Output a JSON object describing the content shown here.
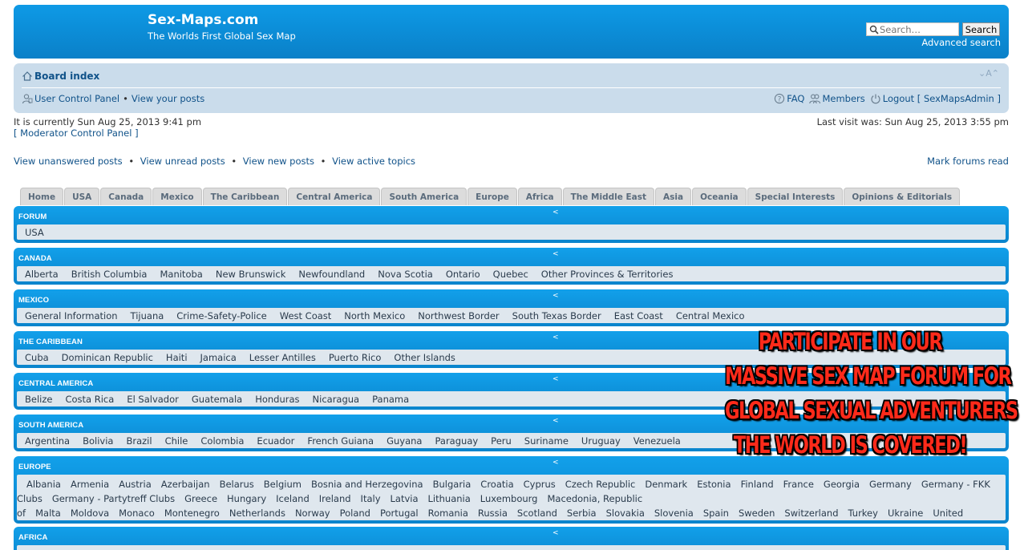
{
  "header": {
    "title": "Sex-Maps.com",
    "description": "The Worlds First Global Sex Map",
    "search_placeholder": "Search…",
    "search_button": "Search",
    "advanced_search": "Advanced search",
    "bg_color": "#0e8fd8"
  },
  "navbar": {
    "board_index": "Board index",
    "font_size_control": "⌄A⌃",
    "ucp": "User Control Panel",
    "view_posts": "View your posts",
    "faq": "FAQ",
    "members": "Members",
    "logout": "Logout [ SexMapsAdmin ]"
  },
  "status": {
    "current_time": "It is currently Sun Aug 25, 2013 9:41 pm",
    "mcp": "[ Moderator Control Panel ]",
    "last_visit": "Last visit was: Sun Aug 25, 2013 3:55 pm"
  },
  "actions": {
    "unanswered": "View unanswered posts",
    "unread": "View unread posts",
    "new": "View new posts",
    "active": "View active topics",
    "mark_read": "Mark forums read"
  },
  "tabs": [
    "Home",
    "USA",
    "Canada",
    "Mexico",
    "The Caribbean",
    "Central America",
    "South America",
    "Europe",
    "Africa",
    "The Middle East",
    "Asia",
    "Oceania",
    "Special Interests",
    "Opinions & Editorials"
  ],
  "caret": "<",
  "blocks": [
    {
      "heading": "Forum",
      "items": [
        "USA"
      ]
    },
    {
      "heading": "Canada",
      "items": [
        "Alberta",
        "British Columbia",
        "Manitoba",
        "New Brunswick",
        "Newfoundland",
        "Nova Scotia",
        "Ontario",
        "Quebec",
        "Other Provinces & Territories"
      ]
    },
    {
      "heading": "Mexico",
      "items": [
        "General Information",
        "Tijuana",
        "Crime-Safety-Police",
        "West Coast",
        "North Mexico",
        "Northwest Border",
        "South Texas Border",
        "East Coast",
        "Central Mexico"
      ]
    },
    {
      "heading": "The Caribbean",
      "items": [
        "Cuba",
        "Dominican Republic",
        "Haiti",
        "Jamaica",
        "Lesser Antilles",
        "Puerto Rico",
        "Other Islands"
      ]
    },
    {
      "heading": "Central America",
      "items": [
        "Belize",
        "Costa Rica",
        "El Salvador",
        "Guatemala",
        "Honduras",
        "Nicaragua",
        "Panama"
      ]
    },
    {
      "heading": "South America",
      "items": [
        "Argentina",
        "Bolivia",
        "Brazil",
        "Chile",
        "Colombia",
        "Ecuador",
        "French Guiana",
        "Guyana",
        "Paraguay",
        "Peru",
        "Suriname",
        "Uruguay",
        "Venezuela"
      ]
    },
    {
      "heading": "Europe",
      "items": [
        "Albania",
        "Armenia",
        "Austria",
        "Azerbaijan",
        "Belarus",
        "Belgium",
        "Bosnia and Herzegovina",
        "Bulgaria",
        "Croatia",
        "Cyprus",
        "Czech Republic",
        "Denmark",
        "Estonia",
        "Finland",
        "France",
        "Georgia",
        "Germany",
        "Germany - FKK Clubs",
        "Germany - Partytreff Clubs",
        "Greece",
        "Hungary",
        "Iceland",
        "Ireland",
        "Italy",
        "Latvia",
        "Lithuania",
        "Luxembourg",
        "Macedonia, Republic of",
        "Malta",
        "Moldova",
        "Monaco",
        "Montenegro",
        "Netherlands",
        "Norway",
        "Poland",
        "Portugal",
        "Romania",
        "Russia",
        "Scotland",
        "Serbia",
        "Slovakia",
        "Slovenia",
        "Spain",
        "Sweden",
        "Switzerland",
        "Turkey",
        "Ukraine",
        "United Kingdom"
      ]
    },
    {
      "heading": "Africa",
      "items": []
    }
  ],
  "promo": {
    "line1": "PARTICIPATE IN OUR",
    "line2": "MASSIVE SEX MAP FORUM FOR",
    "line3": "GLOBAL SEXUAL ADVENTURERS",
    "line4": "THE WORLD IS COVERED!",
    "color": "#ff2a1a"
  }
}
